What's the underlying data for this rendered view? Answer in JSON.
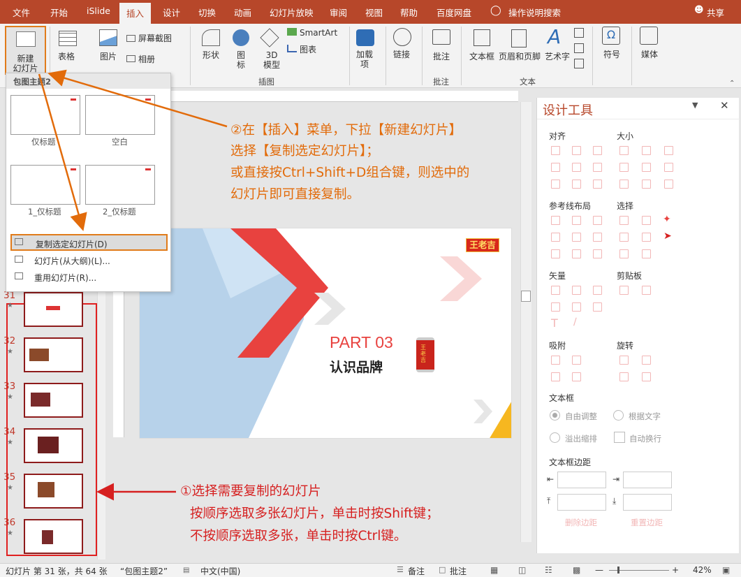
{
  "tabs": [
    "文件",
    "开始",
    "iSlide",
    "插入",
    "设计",
    "切换",
    "动画",
    "幻灯片放映",
    "审阅",
    "视图",
    "帮助",
    "百度网盘",
    "操作说明搜索"
  ],
  "active_tab": "插入",
  "share_label": "共享",
  "ribbon": {
    "new_slide": "新建\n幻灯片",
    "table": "表格",
    "picture": "图片",
    "screenshot": "屏幕截图",
    "album": "相册",
    "shapes": "形状",
    "icons": "图\n标",
    "model3d": "3D\n模型",
    "smartart": "SmartArt",
    "chart": "图表",
    "addins": "加载\n项",
    "link": "链接",
    "comment": "批注",
    "textbox": "文本框",
    "header_footer": "页眉和页脚",
    "wordart": "艺术字",
    "symbol": "符号",
    "media": "媒体",
    "group_images": "插图",
    "group_comments": "批注",
    "group_text": "文本"
  },
  "dropdown": {
    "header": "包图主题2",
    "layouts": [
      "仅标题",
      "空白",
      "1_仅标题",
      "2_仅标题"
    ],
    "items": [
      "复制选定幻灯片(D)",
      "幻灯片(从大纲)(L)...",
      "重用幻灯片(R)..."
    ]
  },
  "thumbnails": [
    {
      "num": "31"
    },
    {
      "num": "32"
    },
    {
      "num": "33"
    },
    {
      "num": "34"
    },
    {
      "num": "35"
    },
    {
      "num": "36"
    }
  ],
  "slide": {
    "logo": "王老吉",
    "part": "PART 03",
    "subtitle": "认识品牌",
    "can_text": "王老吉"
  },
  "pane": {
    "title": "设计工具",
    "sections": [
      "对齐",
      "大小",
      "参考线布局",
      "选择",
      "矢量",
      "剪贴板",
      "吸附",
      "旋转",
      "文本框",
      "文本框边距"
    ],
    "autofit": "自由调整",
    "by_text": "根据文字",
    "overflow": "溢出缩排",
    "wrap": "自动换行",
    "delete_margin": "删除边距",
    "reset_margin": "重置边距"
  },
  "annotations": {
    "step2_line1": "②在【插入】菜单，下拉【新建幻灯片】",
    "step2_line2": "选择【复制选定幻灯片】；",
    "step2_line3": "或直接按Ctrl+Shift+D组合键，则选中的",
    "step2_line4": "幻灯片即可直接复制。",
    "step1_line1": "①选择需要复制的幻灯片",
    "step1_line2": "按顺序选取多张幻灯片，单击时按Shift键；",
    "step1_line3": "不按顺序选取多张，单击时按Ctrl键。"
  },
  "status": {
    "slide_info": "幻灯片 第 31 张，共 64 张",
    "theme": "“包图主题2”",
    "language": "中文(中国)",
    "notes": "备注",
    "comments": "批注",
    "zoom": "42%"
  },
  "colors": {
    "accent": "#b7472a",
    "annotation_orange": "#e26b0a",
    "annotation_red": "#d62020",
    "thumb_border": "#8e1b1b"
  }
}
